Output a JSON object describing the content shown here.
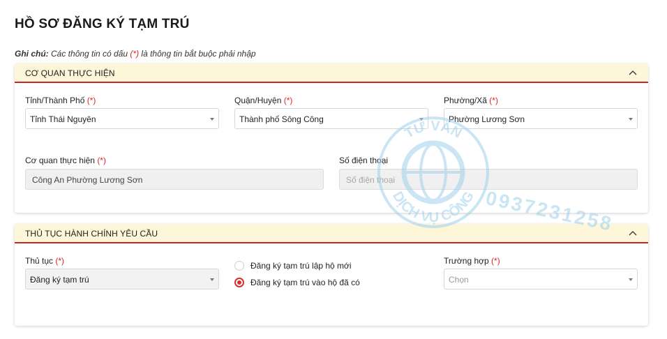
{
  "page": {
    "title": "HỒ SƠ ĐĂNG KÝ TẠM TRÚ",
    "note_label": "Ghi chú:",
    "note_text_before": " Các thông tin có dấu ",
    "note_required": "(*)",
    "note_text_after": " là thông tin bắt buộc phải nhập"
  },
  "required_mark": "(*)",
  "section_agency": {
    "title": "CƠ QUAN THỰC HIỆN",
    "province": {
      "label": "Tỉnh/Thành Phố",
      "value": "Tỉnh Thái Nguyên"
    },
    "district": {
      "label": "Quận/Huyện",
      "value": "Thành phố Sông Công"
    },
    "ward": {
      "label": "Phường/Xã",
      "value": "Phường Lương Sơn"
    },
    "agency": {
      "label": "Cơ quan thực hiện",
      "value": "Công An Phường Lương Sơn"
    },
    "phone": {
      "label": "Số điện thoại",
      "placeholder": "Số điện thoại"
    }
  },
  "section_procedure": {
    "title": "THỦ TỤC HÀNH CHÍNH YÊU CẦU",
    "procedure": {
      "label": "Thủ tục",
      "value": "Đăng ký tạm trú"
    },
    "options": [
      {
        "label": "Đăng ký tạm trú lập hộ mới",
        "checked": false
      },
      {
        "label": "Đăng ký tạm trú vào hộ đã có",
        "checked": true
      }
    ],
    "case": {
      "label": "Trường hợp",
      "placeholder": "Chọn"
    }
  },
  "watermark": {
    "top_text": "TƯ VẤN",
    "bottom_text": "DỊCH VỤ CÔNG",
    "phone": "0937231258"
  },
  "colors": {
    "accent": "#c62828",
    "header_bg": "#fdf6d8",
    "watermark": "#9fd0ec"
  }
}
